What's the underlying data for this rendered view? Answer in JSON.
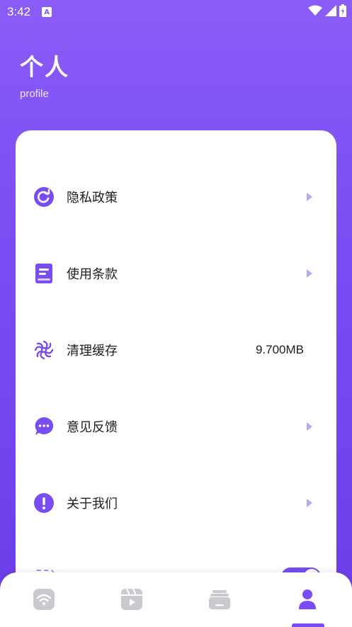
{
  "status_bar": {
    "time": "3:42",
    "app_badge": "A"
  },
  "header": {
    "title": "个人",
    "subtitle": "profile"
  },
  "menu": {
    "items": [
      {
        "label": "隐私政策",
        "icon": "refresh-icon",
        "arrow": true
      },
      {
        "label": "使用条款",
        "icon": "book-icon",
        "arrow": true
      },
      {
        "label": "清理缓存",
        "icon": "spiral-icon",
        "value": "9.700MB"
      },
      {
        "label": "意见反馈",
        "icon": "chat-bubble-icon",
        "arrow": true
      },
      {
        "label": "关于我们",
        "icon": "info-alert-icon",
        "arrow": true
      }
    ]
  },
  "bottom_nav": {
    "tabs": [
      {
        "icon": "wifi-icon",
        "active": false
      },
      {
        "icon": "video-clapper-icon",
        "active": false
      },
      {
        "icon": "stack-icon",
        "active": false
      },
      {
        "icon": "person-icon",
        "active": true
      }
    ]
  },
  "colors": {
    "accent": "#7a4cf3",
    "header_gradient_top": "#8b5cf7",
    "header_gradient_bottom": "#6a3ee8",
    "inactive_nav": "#c9c9cf",
    "arrow": "#b9a8ef"
  }
}
